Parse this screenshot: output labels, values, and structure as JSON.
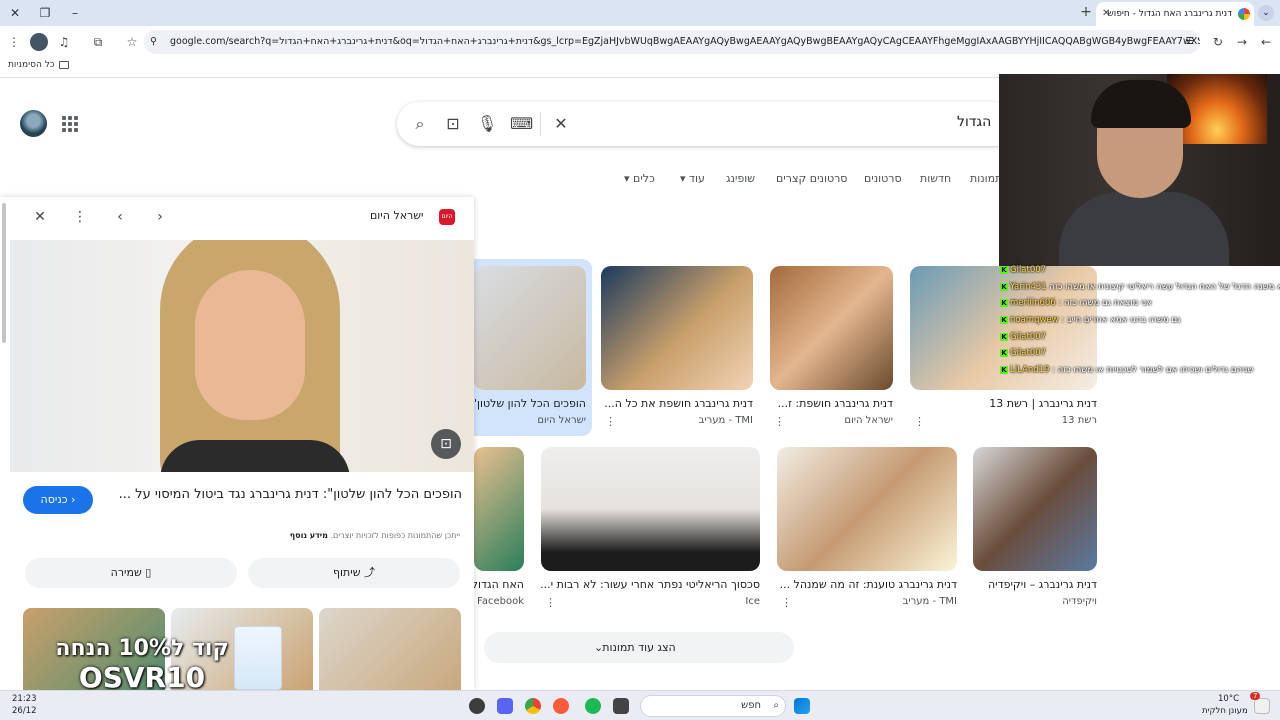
{
  "browser": {
    "tab_title": "דנית גרינברג האח הגדול - חיפוש",
    "url": "google.com/search?q=דנית+גרינברג+האח+הגדול&oq=דנית+גרינברג+האח+הגדול&gs_lcrp=EgZjaHJvbWUqBwgAEAAYgAQyBwgAEAAYgAQyBwgBEAAYgAQyCAgCEAAYFhgeMggIAxAAGBYYHjIICAQQABgWGB4yBwgFEAAY7wXSAQg0MzQ5aj Bq...",
    "bookmarks_folder": "כל הסימניות"
  },
  "search": {
    "query": "הגדול",
    "nav_tabs": [
      "תמונות",
      "חדשות",
      "סרטונים",
      "סרטונים קצרים",
      "שופינג",
      "עוד",
      "כלים"
    ]
  },
  "panel": {
    "source": "ישראל היום",
    "source_logo": "היום",
    "title": "הופכים הכל להון שלטון\": דנית גרינברג נגד ביטול המיסוי על ...",
    "enter_label": "כניסה",
    "copyright_text": "ייתכן שהתמונות כפופות לזכויות יוצרים.",
    "more_info": "מידע נוסף",
    "share_label": "שיתוף",
    "save_label": "שמירה",
    "promo_line1": "קוד ל10% הנחה",
    "promo_line2": "OSVR10"
  },
  "results": [
    {
      "caption": "הופכים הכל להון שלטון\"...",
      "source": "ישראל היום"
    },
    {
      "caption": "דנית גרינברג חושפת את כל ה...",
      "source": "TMI - מעריב"
    },
    {
      "caption": "דנית גרינברג חושפת: ז...",
      "source": "ישראל היום"
    },
    {
      "caption": "דנית גרינברג | רשת 13",
      "source": "רשת 13"
    },
    {
      "caption": "האח הגדול",
      "source": "Facebook"
    },
    {
      "caption": "סכסוך הריאליטי נפתר אחרי עשור: לא רבות י...",
      "source": "Ice"
    },
    {
      "caption": "דנית גרינברג טוענת: זה מה שמנהל ...",
      "source": "TMI - מעריב"
    },
    {
      "caption": "דנית גרינברג – ויקיפדיה",
      "source": "ויקיפדיה"
    }
  ],
  "show_more": "הצג עוד תמונות",
  "chat": [
    {
      "user": "Gilat007",
      "msg": ""
    },
    {
      "user": "Yarin431",
      "msg": "לא משנה הדגל של האח הגדול עשה ריאליטי קיצונית או משהו כזה"
    },
    {
      "user": "merliin606",
      "msg": "אני מוצאת גם משהו כזה"
    },
    {
      "user": "noamqwew",
      "msg": "גם משהו בהגו אמא אחרים חייב"
    },
    {
      "user": "Gilat007",
      "msg": ""
    },
    {
      "user": "Gilat007",
      "msg": ""
    },
    {
      "user": "LiLAnd19",
      "msg": "שגיהם גדולים ושכיתו אם לשמור לטכנויות או משהו כזה"
    }
  ],
  "taskbar": {
    "time": "21:23",
    "date": "26/12",
    "search_label": "חפש",
    "weather_temp": "10°C",
    "weather_desc": "מעונן חלקית",
    "notif_count": "7"
  },
  "colors": {
    "accent": "#1a73e8",
    "tabbar": "#dbe4f3",
    "selected_result": "#d2e3fc"
  }
}
